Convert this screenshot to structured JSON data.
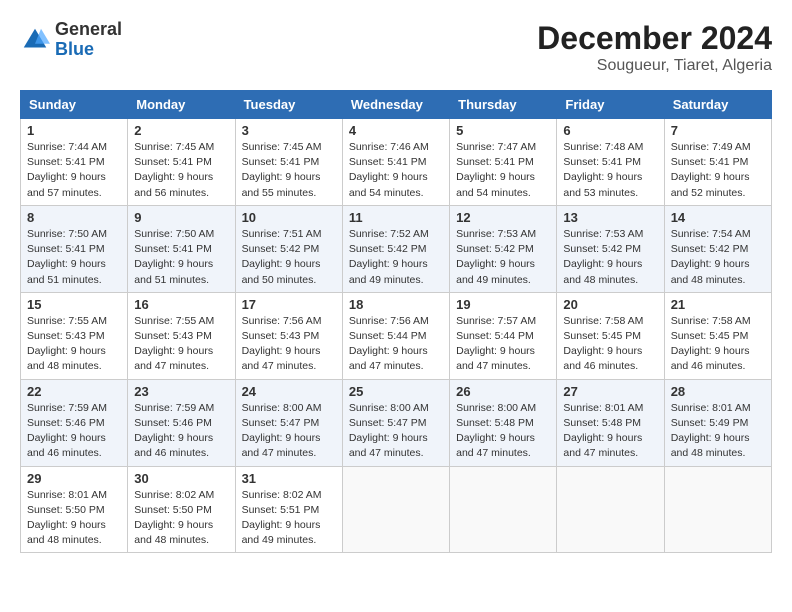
{
  "logo": {
    "text_general": "General",
    "text_blue": "Blue"
  },
  "title": {
    "month_year": "December 2024",
    "location": "Sougueur, Tiaret, Algeria"
  },
  "days_of_week": [
    "Sunday",
    "Monday",
    "Tuesday",
    "Wednesday",
    "Thursday",
    "Friday",
    "Saturday"
  ],
  "weeks": [
    [
      {
        "day": "1",
        "sunrise": "7:44 AM",
        "sunset": "5:41 PM",
        "daylight": "9 hours and 57 minutes."
      },
      {
        "day": "2",
        "sunrise": "7:45 AM",
        "sunset": "5:41 PM",
        "daylight": "9 hours and 56 minutes."
      },
      {
        "day": "3",
        "sunrise": "7:45 AM",
        "sunset": "5:41 PM",
        "daylight": "9 hours and 55 minutes."
      },
      {
        "day": "4",
        "sunrise": "7:46 AM",
        "sunset": "5:41 PM",
        "daylight": "9 hours and 54 minutes."
      },
      {
        "day": "5",
        "sunrise": "7:47 AM",
        "sunset": "5:41 PM",
        "daylight": "9 hours and 54 minutes."
      },
      {
        "day": "6",
        "sunrise": "7:48 AM",
        "sunset": "5:41 PM",
        "daylight": "9 hours and 53 minutes."
      },
      {
        "day": "7",
        "sunrise": "7:49 AM",
        "sunset": "5:41 PM",
        "daylight": "9 hours and 52 minutes."
      }
    ],
    [
      {
        "day": "8",
        "sunrise": "7:50 AM",
        "sunset": "5:41 PM",
        "daylight": "9 hours and 51 minutes."
      },
      {
        "day": "9",
        "sunrise": "7:50 AM",
        "sunset": "5:41 PM",
        "daylight": "9 hours and 51 minutes."
      },
      {
        "day": "10",
        "sunrise": "7:51 AM",
        "sunset": "5:42 PM",
        "daylight": "9 hours and 50 minutes."
      },
      {
        "day": "11",
        "sunrise": "7:52 AM",
        "sunset": "5:42 PM",
        "daylight": "9 hours and 49 minutes."
      },
      {
        "day": "12",
        "sunrise": "7:53 AM",
        "sunset": "5:42 PM",
        "daylight": "9 hours and 49 minutes."
      },
      {
        "day": "13",
        "sunrise": "7:53 AM",
        "sunset": "5:42 PM",
        "daylight": "9 hours and 48 minutes."
      },
      {
        "day": "14",
        "sunrise": "7:54 AM",
        "sunset": "5:42 PM",
        "daylight": "9 hours and 48 minutes."
      }
    ],
    [
      {
        "day": "15",
        "sunrise": "7:55 AM",
        "sunset": "5:43 PM",
        "daylight": "9 hours and 48 minutes."
      },
      {
        "day": "16",
        "sunrise": "7:55 AM",
        "sunset": "5:43 PM",
        "daylight": "9 hours and 47 minutes."
      },
      {
        "day": "17",
        "sunrise": "7:56 AM",
        "sunset": "5:43 PM",
        "daylight": "9 hours and 47 minutes."
      },
      {
        "day": "18",
        "sunrise": "7:56 AM",
        "sunset": "5:44 PM",
        "daylight": "9 hours and 47 minutes."
      },
      {
        "day": "19",
        "sunrise": "7:57 AM",
        "sunset": "5:44 PM",
        "daylight": "9 hours and 47 minutes."
      },
      {
        "day": "20",
        "sunrise": "7:58 AM",
        "sunset": "5:45 PM",
        "daylight": "9 hours and 46 minutes."
      },
      {
        "day": "21",
        "sunrise": "7:58 AM",
        "sunset": "5:45 PM",
        "daylight": "9 hours and 46 minutes."
      }
    ],
    [
      {
        "day": "22",
        "sunrise": "7:59 AM",
        "sunset": "5:46 PM",
        "daylight": "9 hours and 46 minutes."
      },
      {
        "day": "23",
        "sunrise": "7:59 AM",
        "sunset": "5:46 PM",
        "daylight": "9 hours and 46 minutes."
      },
      {
        "day": "24",
        "sunrise": "8:00 AM",
        "sunset": "5:47 PM",
        "daylight": "9 hours and 47 minutes."
      },
      {
        "day": "25",
        "sunrise": "8:00 AM",
        "sunset": "5:47 PM",
        "daylight": "9 hours and 47 minutes."
      },
      {
        "day": "26",
        "sunrise": "8:00 AM",
        "sunset": "5:48 PM",
        "daylight": "9 hours and 47 minutes."
      },
      {
        "day": "27",
        "sunrise": "8:01 AM",
        "sunset": "5:48 PM",
        "daylight": "9 hours and 47 minutes."
      },
      {
        "day": "28",
        "sunrise": "8:01 AM",
        "sunset": "5:49 PM",
        "daylight": "9 hours and 48 minutes."
      }
    ],
    [
      {
        "day": "29",
        "sunrise": "8:01 AM",
        "sunset": "5:50 PM",
        "daylight": "9 hours and 48 minutes."
      },
      {
        "day": "30",
        "sunrise": "8:02 AM",
        "sunset": "5:50 PM",
        "daylight": "9 hours and 48 minutes."
      },
      {
        "day": "31",
        "sunrise": "8:02 AM",
        "sunset": "5:51 PM",
        "daylight": "9 hours and 49 minutes."
      },
      null,
      null,
      null,
      null
    ]
  ],
  "labels": {
    "sunrise": "Sunrise:",
    "sunset": "Sunset:",
    "daylight": "Daylight:"
  }
}
